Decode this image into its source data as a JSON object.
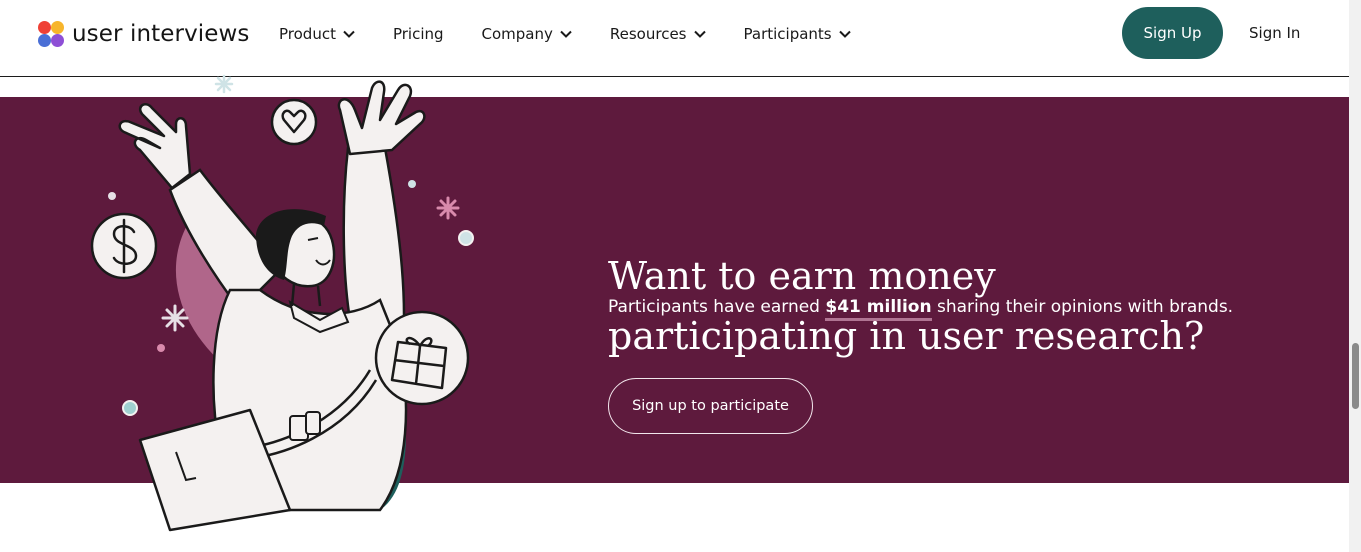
{
  "brand": {
    "name": "user interviews",
    "colors": {
      "red": "#ef4136",
      "yellow": "#f7b52c",
      "blue": "#4a6fd6",
      "purple": "#8e4fd6"
    }
  },
  "nav": {
    "items": [
      {
        "label": "Product",
        "dropdown": true
      },
      {
        "label": "Pricing",
        "dropdown": false
      },
      {
        "label": "Company",
        "dropdown": true
      },
      {
        "label": "Resources",
        "dropdown": true
      },
      {
        "label": "Participants",
        "dropdown": true
      }
    ],
    "signup_label": "Sign Up",
    "signin_label": "Sign In"
  },
  "hero": {
    "headline_line1": "Want to earn money",
    "headline_line2": "participating in user research?",
    "sub_prefix": "Participants have earned ",
    "sub_highlight": "$41 million",
    "sub_suffix": " sharing their opinions with brands.",
    "cta_label": "Sign up to participate",
    "background_color": "#5e1a3d",
    "accent_color": "#1e5f5c"
  },
  "icons": [
    "heart-icon",
    "dollar-icon",
    "gift-icon",
    "sparkle-icon",
    "chevron-down-icon"
  ]
}
